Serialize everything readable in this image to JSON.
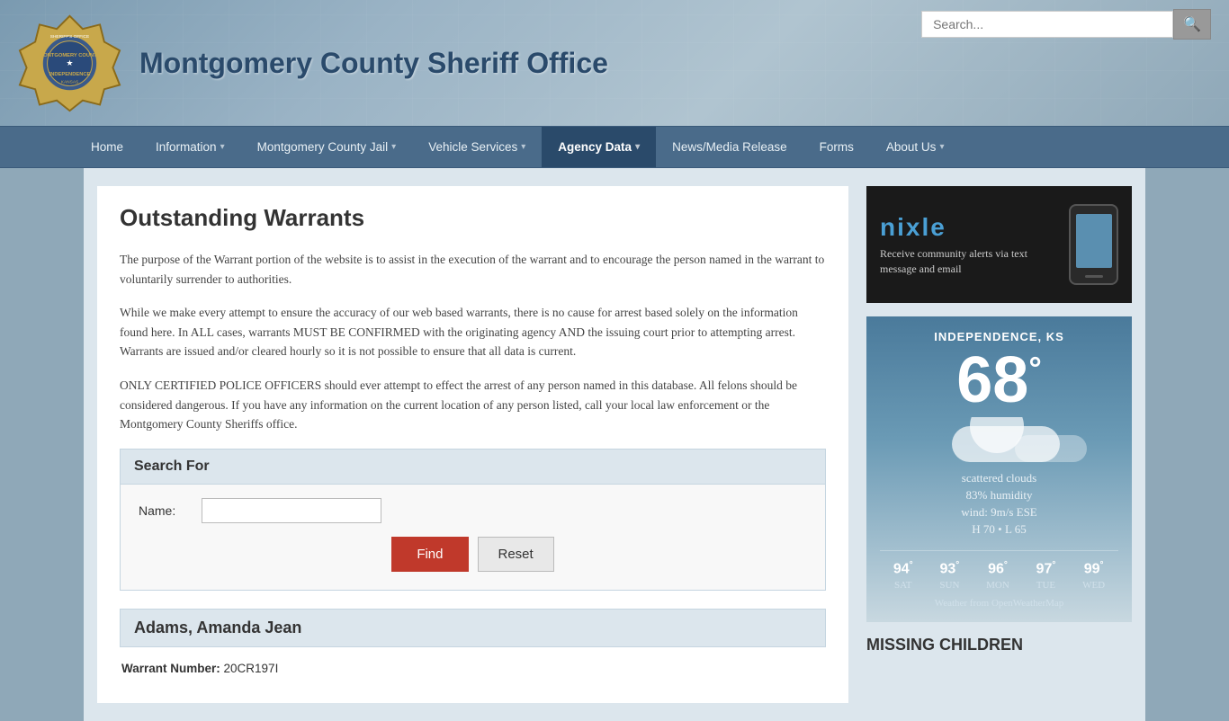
{
  "header": {
    "site_title": "Montgomery County Sheriff Office",
    "logo_alt": "Montgomery County Sheriff Office Badge"
  },
  "search": {
    "placeholder": "Search...",
    "button_label": "🔍"
  },
  "nav": {
    "items": [
      {
        "id": "home",
        "label": "Home",
        "has_dropdown": false,
        "active": false
      },
      {
        "id": "information",
        "label": "Information",
        "has_dropdown": true,
        "active": false
      },
      {
        "id": "montgomery-county-jail",
        "label": "Montgomery County Jail",
        "has_dropdown": true,
        "active": false
      },
      {
        "id": "vehicle-services",
        "label": "Vehicle Services",
        "has_dropdown": true,
        "active": false
      },
      {
        "id": "agency-data",
        "label": "Agency Data",
        "has_dropdown": true,
        "active": true
      },
      {
        "id": "news-media-release",
        "label": "News/Media Release",
        "has_dropdown": false,
        "active": false
      },
      {
        "id": "forms",
        "label": "Forms",
        "has_dropdown": false,
        "active": false
      },
      {
        "id": "about-us",
        "label": "About Us",
        "has_dropdown": true,
        "active": false
      }
    ]
  },
  "page": {
    "title": "Outstanding Warrants",
    "paragraphs": [
      "The purpose of the Warrant portion of the website is to assist in the execution of the warrant  and to encourage the person named in the warrant to voluntarily surrender to authorities.",
      "While we make every attempt to ensure the accuracy of our web based warrants, there is no cause for arrest based solely on the information found here.  In ALL cases, warrants MUST BE CONFIRMED with the originating agency AND the issuing court prior to attempting arrest.  Warrants are issued and/or cleared hourly so it is not possible to ensure that all data is current.",
      "ONLY CERTIFIED POLICE OFFICERS should ever attempt to effect the arrest of any person named in this database.  All felons should be considered dangerous. If you have any information on the current location of any person listed, call your local law enforcement or the Montgomery County Sheriffs office."
    ]
  },
  "search_form": {
    "section_label": "Search For",
    "name_label": "Name:",
    "name_placeholder": "",
    "find_button": "Find",
    "reset_button": "Reset"
  },
  "warrant_result": {
    "name": "Adams, Amanda Jean",
    "warrant_number_label": "Warrant Number:",
    "warrant_number": "20CR197I"
  },
  "nixle": {
    "logo": "nixle",
    "description": "Receive community alerts\nvia text message and email"
  },
  "weather": {
    "location": "INDEPENDENCE, KS",
    "temperature": "68",
    "degree_symbol": "°",
    "condition": "scattered clouds",
    "humidity": "83% humidity",
    "wind": "wind: 9m/s ESE",
    "high": "H 70",
    "low": "L 65",
    "forecast": [
      {
        "day": "SAT",
        "temp": "94",
        "symbol": "°"
      },
      {
        "day": "SUN",
        "temp": "93",
        "symbol": "°"
      },
      {
        "day": "MON",
        "temp": "96",
        "symbol": "°"
      },
      {
        "day": "TUE",
        "temp": "97",
        "symbol": "°"
      },
      {
        "day": "WED",
        "temp": "99",
        "symbol": "°"
      }
    ],
    "credit": "Weather from OpenWeatherMap"
  },
  "missing_children": {
    "title": "MISSING CHILDREN"
  }
}
